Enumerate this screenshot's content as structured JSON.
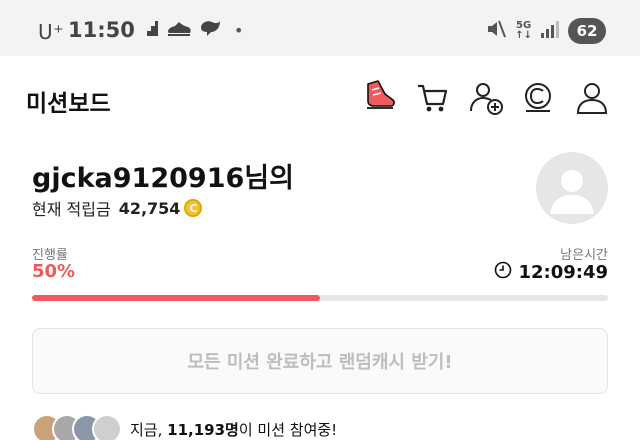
{
  "status_bar": {
    "carrier": "U⁺",
    "time": "11:50",
    "notif_icons": [
      "stairs-icon",
      "sneaker-icon",
      "swirl-icon"
    ],
    "dot": "•",
    "right_icons": [
      "mute-icon",
      "5g-icon",
      "signal-icon"
    ],
    "network": "5G",
    "battery": "62"
  },
  "header": {
    "title": "미션보드",
    "icons": [
      "shoe-icon",
      "cart-icon",
      "add-friend-icon",
      "coin-c-icon",
      "profile-icon"
    ]
  },
  "user": {
    "name": "gjcka9120916님의",
    "points_label": "현재 적립금",
    "points_value": "42,754",
    "coin_symbol": "C"
  },
  "progress": {
    "label": "진행률",
    "percent_text": "50%",
    "percent": 50,
    "remain_label": "남은시간",
    "remain_time": "12:09:49"
  },
  "cta": {
    "label": "모든 미션 완료하고 랜덤캐시 받기!"
  },
  "participants": {
    "prefix": "지금,",
    "count": "11,193명",
    "suffix": "이 미션 참여중!"
  },
  "colors": {
    "accent": "#f05a5a",
    "progress_track": "#e7e7e7",
    "coin": "#f2c230",
    "status_bg": "#f3f3f3"
  }
}
